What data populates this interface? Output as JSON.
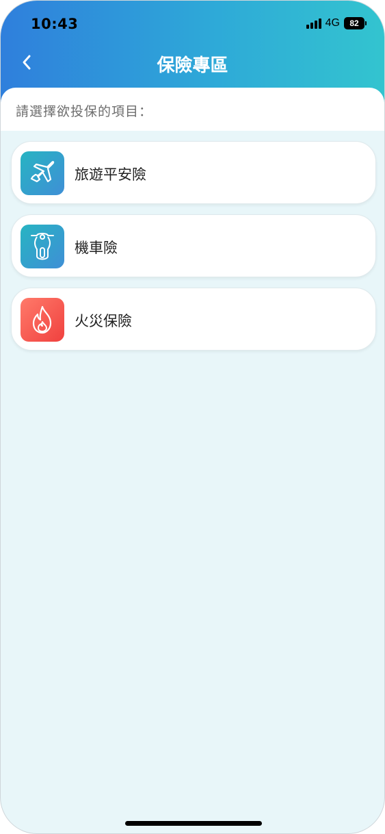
{
  "status_bar": {
    "time": "10:43",
    "network": "4G",
    "battery": "82"
  },
  "header": {
    "title": "保險專區",
    "back_icon": "chevron-left-icon"
  },
  "prompt": "請選擇欲投保的項目：",
  "items": [
    {
      "label": "旅遊平安險",
      "icon": "airplane-icon",
      "color": "#2f9fd0"
    },
    {
      "label": "機車險",
      "icon": "scooter-icon",
      "color": "#2f9fd0"
    },
    {
      "label": "火災保險",
      "icon": "fire-icon",
      "color": "#f0413f"
    }
  ],
  "colors": {
    "header_gradient_start": "#2f7fdc",
    "header_gradient_end": "#33c4cf",
    "background": "#e8f6f9"
  }
}
